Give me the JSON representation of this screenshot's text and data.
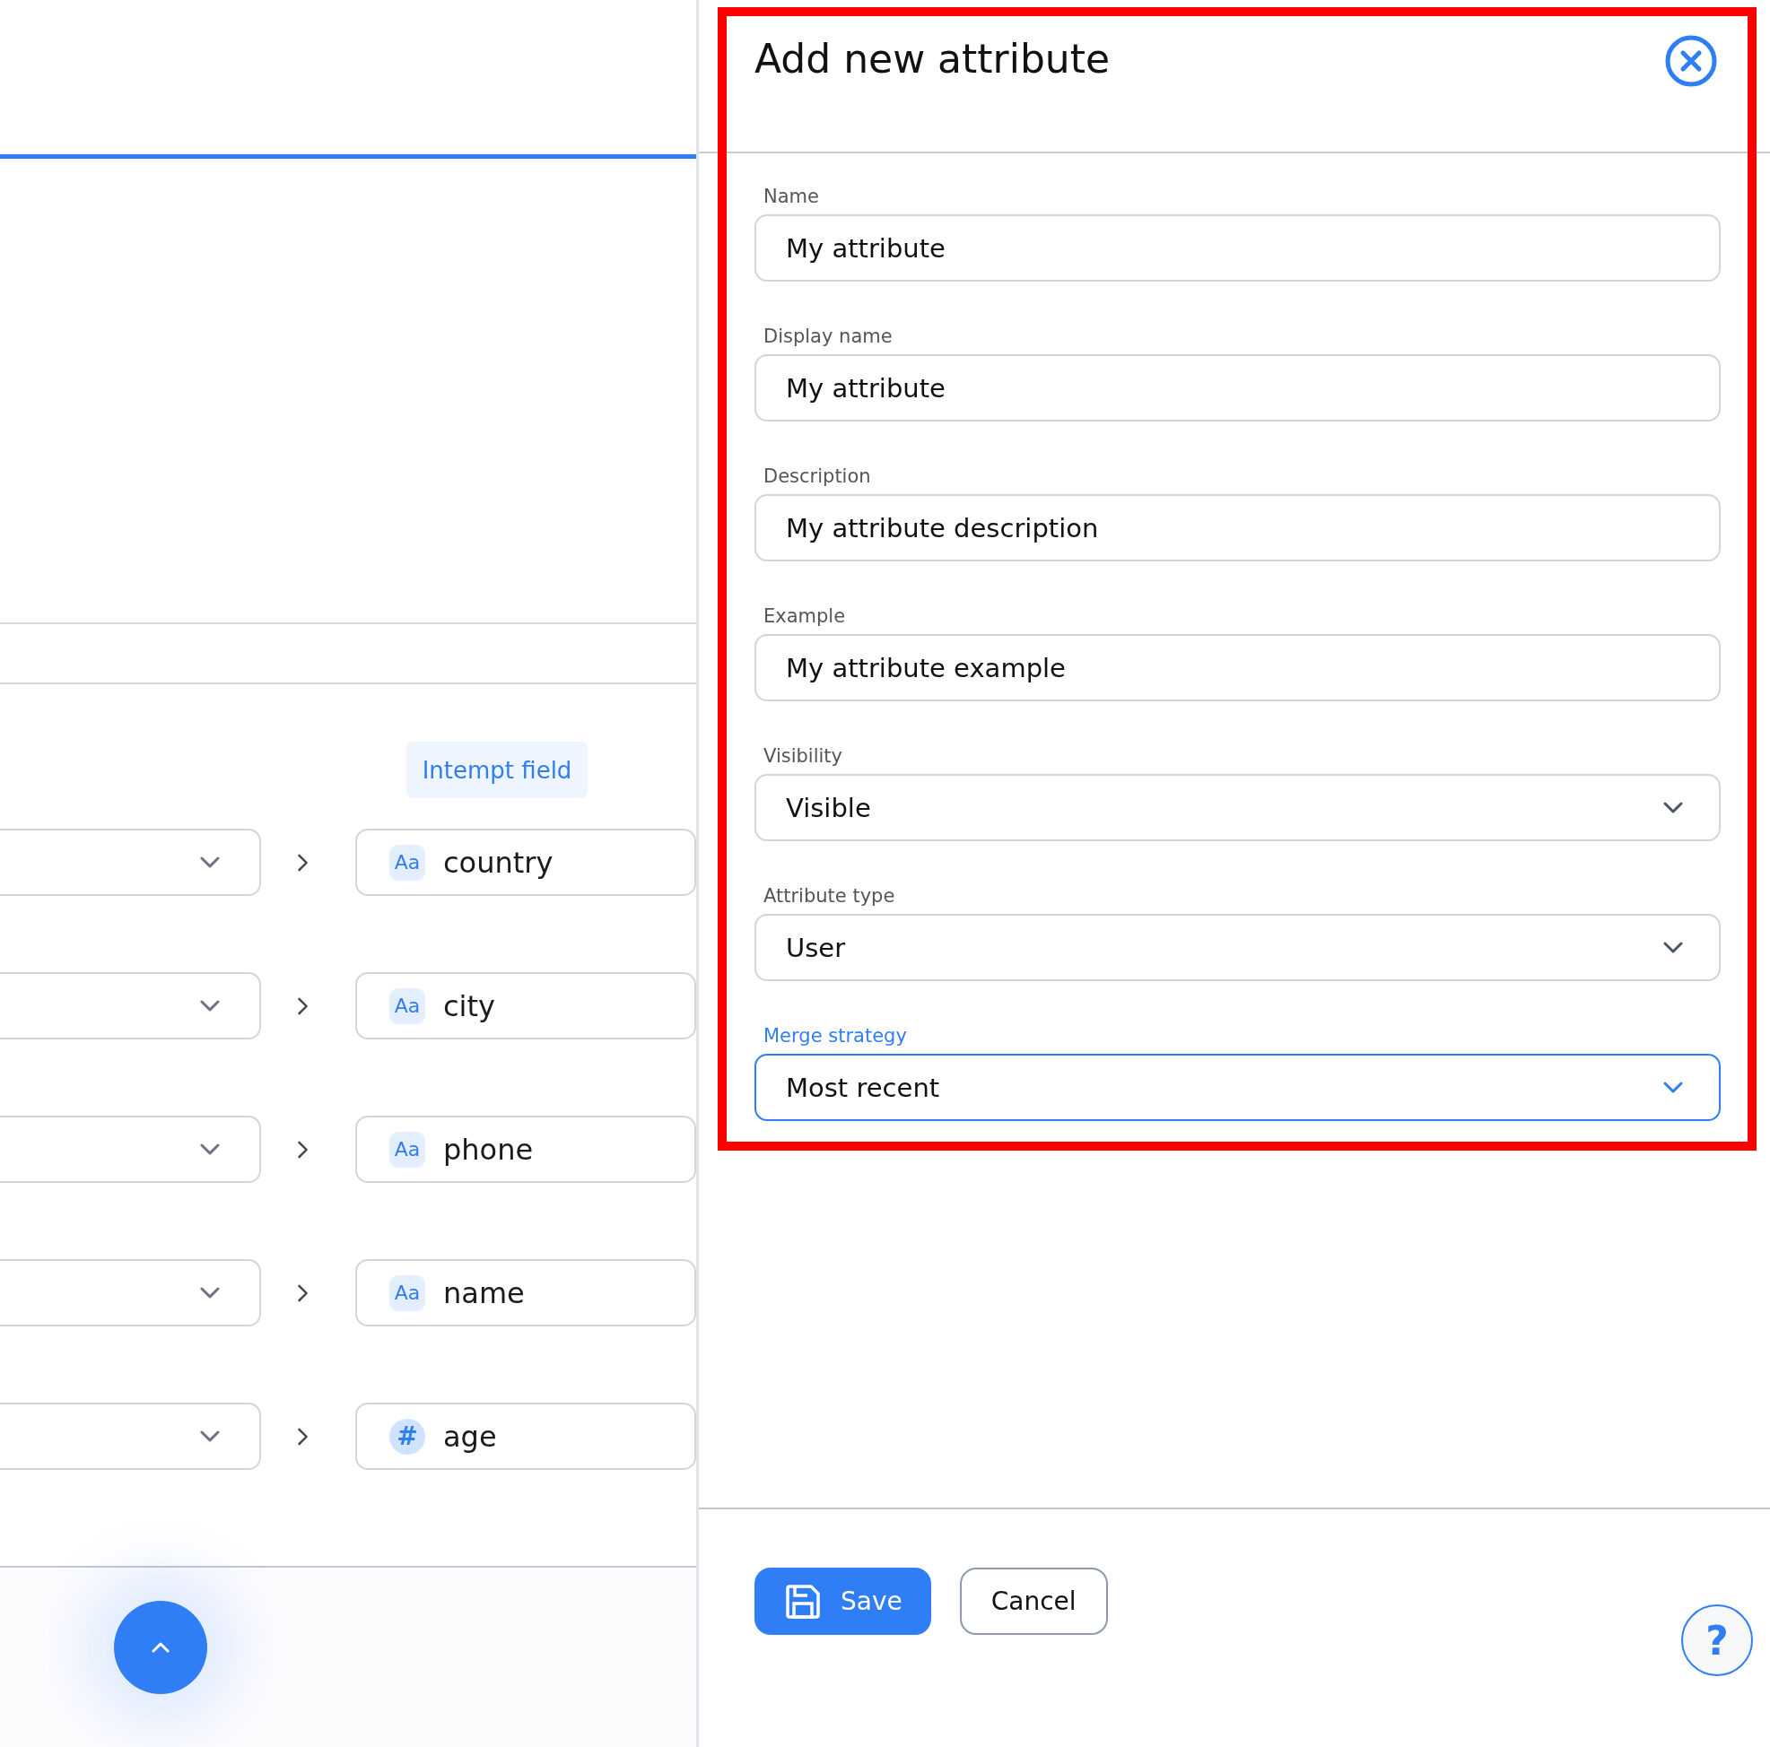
{
  "mapping": {
    "column_header": "Intempt field",
    "rows": [
      {
        "field": "country",
        "type_icon": "Aa"
      },
      {
        "field": "city",
        "type_icon": "Aa"
      },
      {
        "field": "phone",
        "type_icon": "Aa"
      },
      {
        "field": "name",
        "type_icon": "Aa"
      },
      {
        "field": "age",
        "type_icon": "#"
      }
    ]
  },
  "dialog": {
    "title": "Add new attribute",
    "fields": [
      {
        "label": "Name",
        "kind": "text",
        "value": "My attribute",
        "focused": false
      },
      {
        "label": "Display name",
        "kind": "text",
        "value": "My attribute",
        "focused": false
      },
      {
        "label": "Description",
        "kind": "text",
        "value": "My attribute description",
        "focused": false
      },
      {
        "label": "Example",
        "kind": "text",
        "value": "My attribute example",
        "focused": false
      },
      {
        "label": "Visibility",
        "kind": "select",
        "value": "Visible",
        "focused": false
      },
      {
        "label": "Attribute type",
        "kind": "select",
        "value": "User",
        "focused": false
      },
      {
        "label": "Merge strategy",
        "kind": "select",
        "value": "Most recent",
        "focused": true
      }
    ],
    "buttons": [
      {
        "label": "Save",
        "kind": "primary"
      },
      {
        "label": "Cancel",
        "kind": "secondary"
      }
    ]
  },
  "help": {
    "label": "?"
  }
}
